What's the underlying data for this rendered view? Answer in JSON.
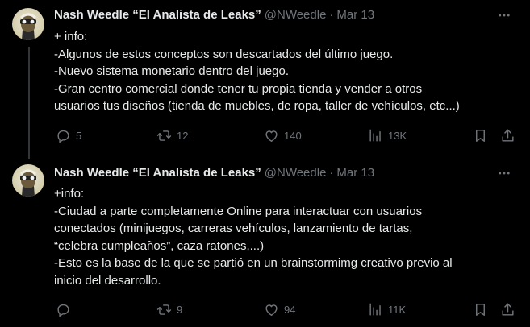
{
  "tweets": [
    {
      "author_name": "Nash Weedle “El Analista de Leaks”",
      "handle": "@NWeedle",
      "separator": "·",
      "date": "Mar 13",
      "lines": [
        "+ info:",
        "-Algunos de estos conceptos son descartados del último juego.",
        "-Nuevo sistema monetario dentro del juego.",
        "-Gran centro comercial donde tener tu propia tienda y vender a otros",
        "usuarios tus diseños (tienda de muebles, de ropa, taller de vehículos, etc...)"
      ],
      "actions": {
        "replies": "5",
        "reposts": "12",
        "likes": "140",
        "views": "13K"
      }
    },
    {
      "author_name": "Nash Weedle “El Analista de Leaks”",
      "handle": "@NWeedle",
      "separator": "·",
      "date": "Mar 13",
      "lines": [
        "+info:",
        "-Ciudad a parte completamente Online para interactuar con usuarios",
        "conectados (minijuegos, carreras vehículos, lanzamiento de tartas,",
        "“celebra cumpleaños”, caza ratones,...)",
        "-Esto es la base de la que se partió en un brainstormimg creativo previo al",
        "inicio del desarrollo."
      ],
      "actions": {
        "replies": "",
        "reposts": "9",
        "likes": "94",
        "views": "11K"
      }
    }
  ],
  "icons": {
    "more": "more-horizontal-icon",
    "reply": "reply-icon",
    "repost": "repost-icon",
    "like": "heart-icon",
    "views": "views-chart-icon",
    "bookmark": "bookmark-icon",
    "share": "share-icon"
  },
  "colors": {
    "background": "#000000",
    "text": "#e7e9ea",
    "secondary": "#71767b",
    "divider": "#333639"
  }
}
